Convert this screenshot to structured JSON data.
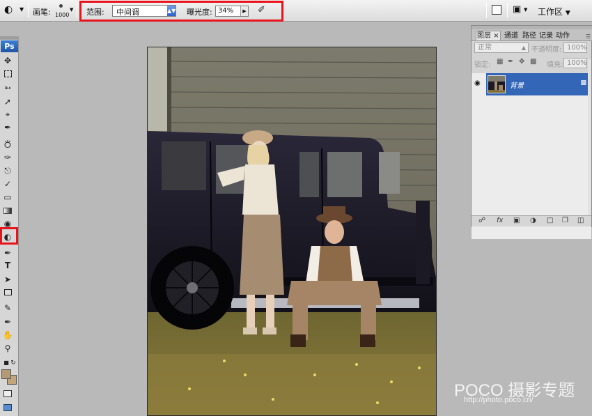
{
  "options_bar": {
    "brush_label": "画笔:",
    "brush_size": "1000",
    "range_label": "范围:",
    "range_value": "中间调",
    "exposure_label": "曝光度:",
    "exposure_value": "34%",
    "workspace_label": "工作区"
  },
  "toolbox": {
    "logo": "Ps",
    "active_tool": "dodge-tool",
    "foreground_color": "#b49a74",
    "background_color": "#c4a57a"
  },
  "layers_panel": {
    "tabs": [
      "图层",
      "通道",
      "路径",
      "记录",
      "动作"
    ],
    "blend_mode": "正常",
    "opacity_label": "不透明度:",
    "opacity_value": "100%",
    "lock_label": "锁定:",
    "fill_label": "填充:",
    "fill_value": "100%",
    "layers": [
      {
        "name": "背景",
        "visible": true,
        "selected": true,
        "locked": true
      }
    ]
  },
  "watermark": {
    "brand": "POCO 摄影专题",
    "url": "http://photo.poco.cn/"
  },
  "colors": {
    "highlight": "#e8141c",
    "selection": "#3466b8"
  }
}
